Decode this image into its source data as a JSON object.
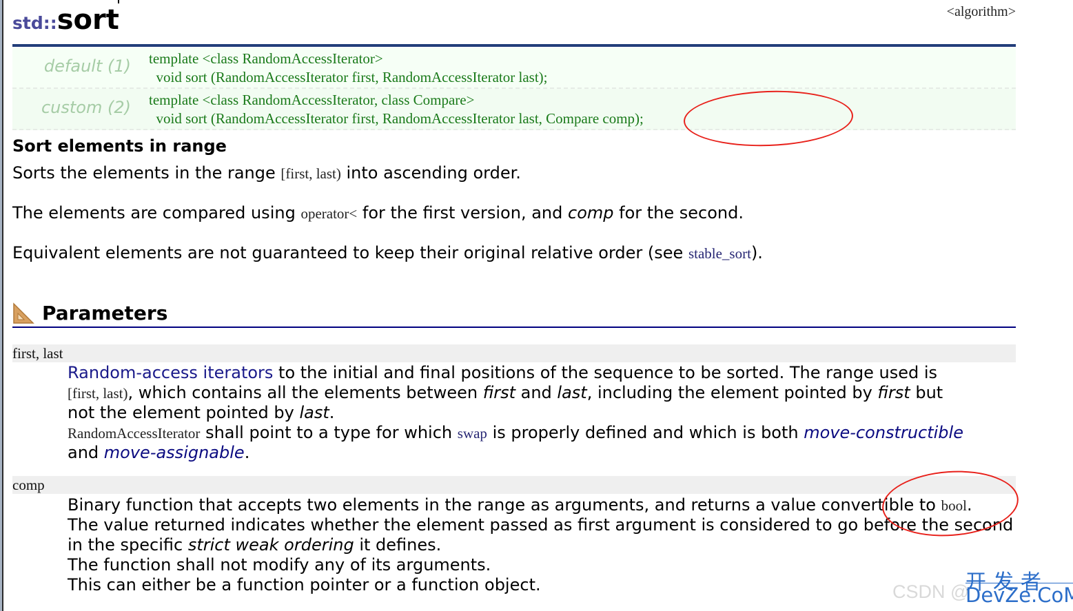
{
  "header": {
    "namespace": "std::",
    "function_name": "sort",
    "header_file": "<algorithm>"
  },
  "prototypes": [
    {
      "label": "default (1)",
      "lines": [
        "template <class RandomAccessIterator>",
        "  void sort (RandomAccessIterator first, RandomAccessIterator last);"
      ]
    },
    {
      "label": "custom (2)",
      "lines": [
        "template <class RandomAccessIterator, class Compare>",
        "  void sort (RandomAccessIterator first, RandomAccessIterator last, Compare comp);"
      ]
    }
  ],
  "description": {
    "heading": "Sort elements in range",
    "p1": {
      "before": "Sorts the elements in the range ",
      "code": "[first, last)",
      "after": " into ascending order."
    },
    "p2": {
      "before": "The elements are compared using ",
      "code": "operator<",
      "middle": " for the first version, and ",
      "em": "comp",
      "after": " for the second."
    },
    "p3": {
      "before": "Equivalent elements are not guaranteed to keep their original relative order (see ",
      "link": "stable_sort",
      "after": ")."
    }
  },
  "parameters": {
    "heading": "Parameters",
    "icon": "set-square-icon",
    "items": [
      {
        "name": "first, last",
        "line1": {
          "link": "Random-access iterators",
          "text": " to the initial and final positions of the sequence to be sorted. The range used is"
        },
        "line2": {
          "code": "[first, last)",
          "t1": ", which contains all the elements between ",
          "em1": "first",
          "t2": " and ",
          "em2": "last",
          "t3": ", including the element pointed by ",
          "em3": "first",
          "t4": " but"
        },
        "line3": {
          "text": "not the element pointed by ",
          "em": "last",
          "after": "."
        },
        "line4": {
          "code": "RandomAccessIterator",
          "t1": " shall point to a type for which ",
          "link": "swap",
          "t2": " is properly defined and which is both ",
          "em": "move-constructible"
        },
        "line5": {
          "text": "and ",
          "em": "move-assignable",
          "after": "."
        }
      },
      {
        "name": "comp",
        "line1": {
          "text": "Binary function that accepts two elements in the range as arguments, and returns a value convertible to ",
          "code": "bool",
          "after": "."
        },
        "line2": {
          "text": "The value returned indicates whether the element passed as first argument is considered to go before the second"
        },
        "line3": {
          "text": "in the specific ",
          "em": "strict weak ordering",
          "after": " it defines."
        },
        "line4": {
          "text": "The function shall not modify any of its arguments."
        },
        "line5": {
          "text": "This can either be a function pointer or a function object."
        }
      }
    ]
  },
  "annotations": {
    "color": "#e8201a",
    "circled": [
      "Compare comp",
      "bool"
    ]
  },
  "watermark": {
    "csdn": "CSDN @",
    "cn": "开发者",
    "en": "DevZe.CoM"
  }
}
